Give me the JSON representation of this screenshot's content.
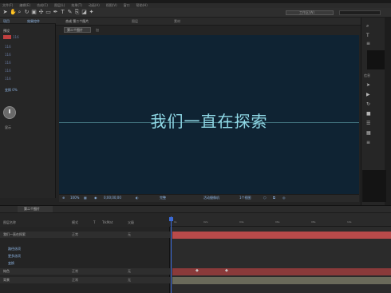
{
  "menu": {
    "items": [
      "文件(F)",
      "编辑(E)",
      "合成(C)",
      "图层(L)",
      "效果(T)",
      "动画(A)",
      "视图(V)",
      "窗口",
      "帮助(H)"
    ]
  },
  "toolbar": {
    "workspace_label": "工作区(W)",
    "tools": [
      "selection-tool",
      "hand-tool",
      "zoom-tool",
      "rotate-tool",
      "camera-tool",
      "pan-behind-tool",
      "mask-tool",
      "pen-tool",
      "text-tool",
      "brush-tool",
      "clone-tool",
      "eraser-tool",
      "puppet-tool"
    ]
  },
  "project_panel": {
    "tab_label": "项目",
    "tab_label_2": "效果控件",
    "rows": [
      "预设",
      "116",
      "116",
      "116",
      "116",
      "116"
    ],
    "name_field": "116",
    "controls_label": "变换 0%",
    "checkbox_label": "显示"
  },
  "composition": {
    "tab_label": "合成 第二个图片",
    "tab_label_2": "图层",
    "tab_label_3": "素材",
    "subtab_label": "第二个图片",
    "subtab_label_2": "加",
    "text": "我们一直在探索",
    "zoom": "100%",
    "timecode": "0;00;00;00",
    "quality": "完整",
    "camera": "活动摄像机",
    "views": "1个视图"
  },
  "timeline": {
    "tab_label": "第二个图片",
    "columns": [
      "图层名称",
      "模式",
      "T",
      "TrkMat",
      "父级"
    ],
    "layers": [
      {
        "name": "我们一直在探索",
        "mode": "正常",
        "parent": "无",
        "color": "#b84a4a"
      },
      {
        "name": "路径选项",
        "mode": "",
        "parent": "",
        "color": "#8a8a8a"
      },
      {
        "name": "更多选项",
        "mode": "",
        "parent": "",
        "color": "#8a8a8a"
      },
      {
        "name": "变换",
        "mode": "",
        "parent": "",
        "color": "#8a8a8a"
      },
      {
        "name": "纯色",
        "mode": "正常",
        "parent": "无",
        "color": "#b84a4a"
      },
      {
        "name": "背景",
        "mode": "正常",
        "parent": "无",
        "color": "#b84a4a"
      }
    ],
    "ticks": [
      "0s",
      "02s",
      "04s",
      "06s",
      "08s",
      "10s"
    ]
  },
  "right_panel": {
    "labels": [
      "信息",
      "音频",
      "预览",
      "效果和预设",
      "对齐",
      "段落",
      "字符"
    ]
  },
  "colors": {
    "viewer_bg": "#0f2333",
    "text_color": "#8fd8e6",
    "layer_bar": "#b84a4a",
    "playhead": "#3b6ad6"
  }
}
